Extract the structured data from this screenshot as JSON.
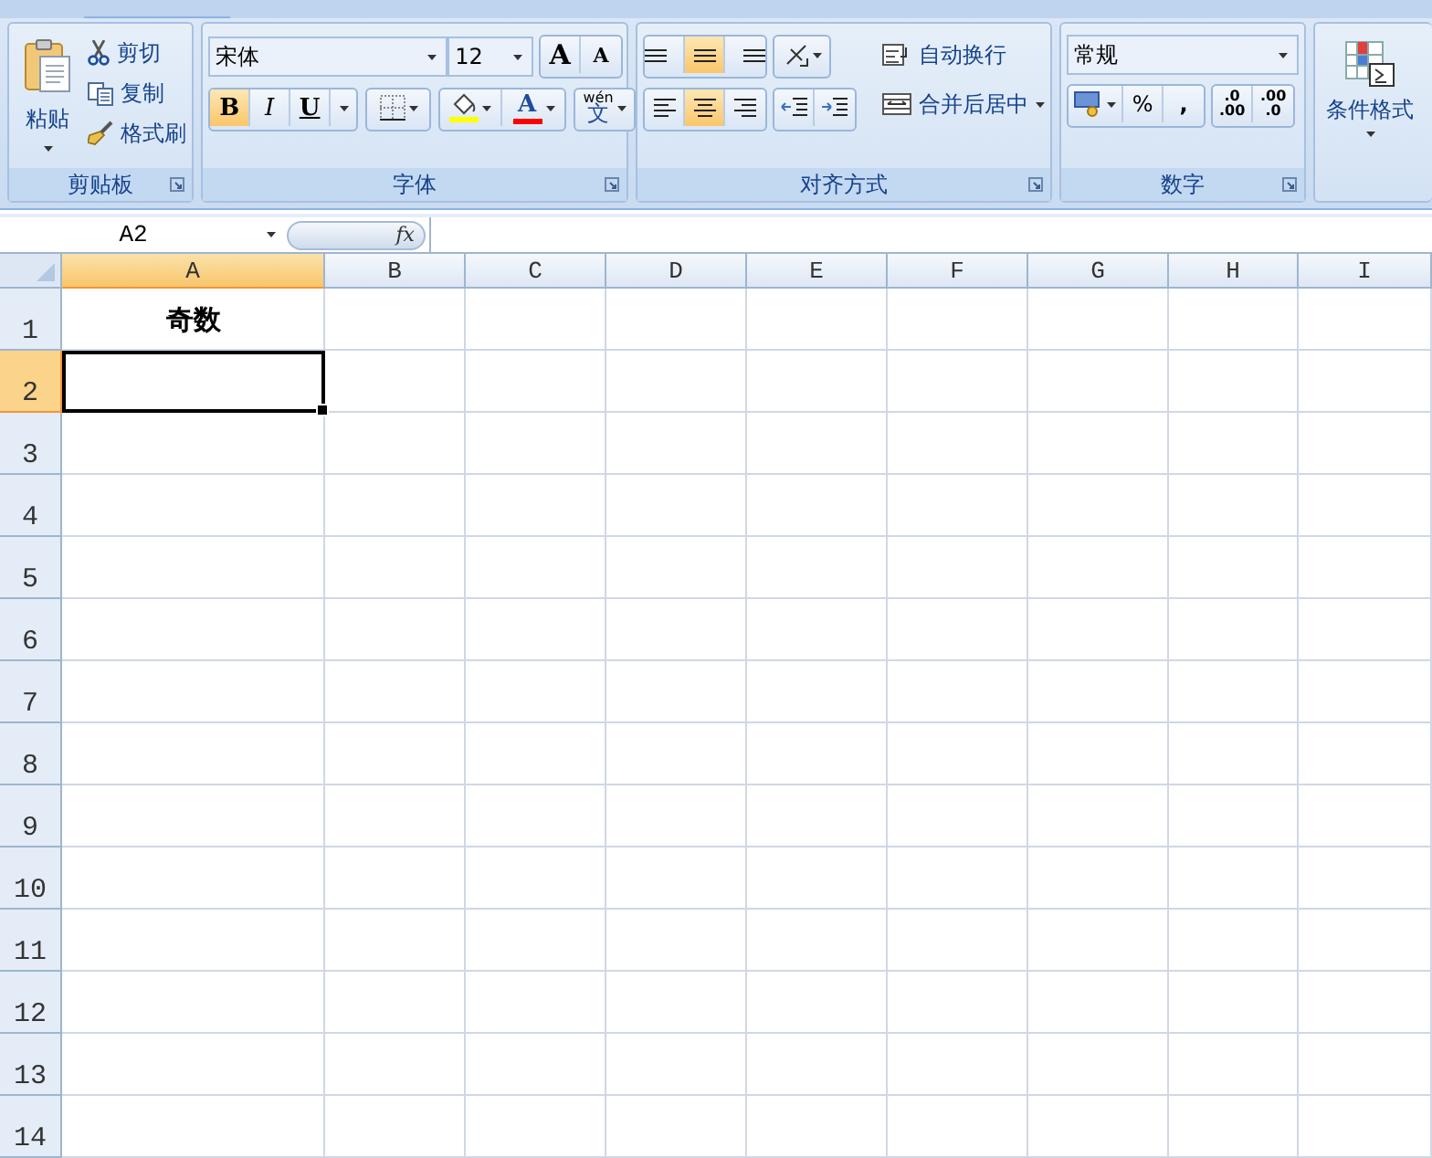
{
  "ribbon": {
    "clipboard": {
      "paste": "粘贴",
      "items": [
        {
          "kind": "cut",
          "label": "剪切"
        },
        {
          "kind": "copy",
          "label": "复制"
        },
        {
          "kind": "brush",
          "label": "格式刷"
        }
      ],
      "title": "剪贴板"
    },
    "font": {
      "name": "宋体",
      "size": "12",
      "grow": "A",
      "shrink": "A",
      "styles": [
        {
          "kind": "bold",
          "label": "B",
          "selected": true
        },
        {
          "kind": "italic",
          "label": "I",
          "selected": false
        },
        {
          "kind": "underline",
          "label": "U",
          "selected": false
        }
      ],
      "font_color": {
        "label": "A"
      },
      "phonetic": {
        "top": "wén",
        "main": "文"
      },
      "title": "字体"
    },
    "alignment": {
      "vertical": [
        {
          "selected": false
        },
        {
          "selected": true
        },
        {
          "selected": false
        }
      ],
      "horizontal": [
        {
          "selected": false
        },
        {
          "selected": true
        },
        {
          "selected": false
        }
      ],
      "wrap": "自动换行",
      "merge": "合并后居中",
      "title": "对齐方式"
    },
    "number": {
      "format": "常规",
      "percent": "%",
      "comma": ",",
      "increase": {
        "top": ".0",
        "bottom": ".00"
      },
      "decrease": {
        "top": ".00",
        "bottom": ".0"
      },
      "title": "数字"
    },
    "styles": {
      "conditional": "条件格式"
    }
  },
  "formula_bar": {
    "name_box": "A2",
    "fx": "fx"
  },
  "sheet": {
    "columns": [
      {
        "label": "A",
        "selected": true
      },
      {
        "label": "B",
        "selected": false
      },
      {
        "label": "C",
        "selected": false
      },
      {
        "label": "D",
        "selected": false
      },
      {
        "label": "E",
        "selected": false
      },
      {
        "label": "F",
        "selected": false
      },
      {
        "label": "G",
        "selected": false
      },
      {
        "label": "H",
        "selected": false
      },
      {
        "label": "I",
        "selected": false
      }
    ],
    "rows": [
      {
        "label": "1",
        "selected": false,
        "cells": [
          {
            "text": "奇数",
            "bold": true
          }
        ]
      },
      {
        "label": "2",
        "selected": true
      },
      {
        "label": "3",
        "selected": false
      },
      {
        "label": "4",
        "selected": false
      },
      {
        "label": "5",
        "selected": false
      },
      {
        "label": "6",
        "selected": false
      },
      {
        "label": "7",
        "selected": false
      },
      {
        "label": "8",
        "selected": false
      },
      {
        "label": "9",
        "selected": false
      },
      {
        "label": "10",
        "selected": false
      },
      {
        "label": "11",
        "selected": false
      },
      {
        "label": "12",
        "selected": false
      },
      {
        "label": "13",
        "selected": false
      },
      {
        "label": "14",
        "selected": false
      }
    ]
  }
}
